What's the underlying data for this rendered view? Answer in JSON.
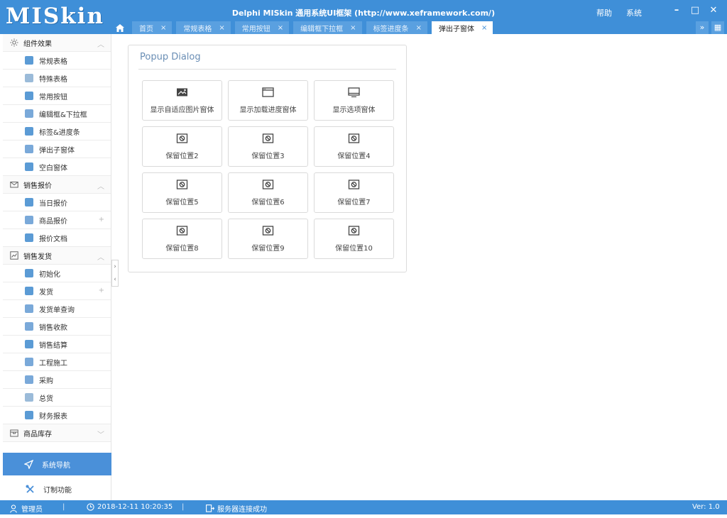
{
  "app": {
    "logo": "MISkin",
    "title": "Delphi MISkin 通用系统UI框架 (http://www.xeframework.com/)",
    "top_links": [
      "帮助",
      "系统"
    ],
    "window_controls": {
      "minimize": "–",
      "maximize": "□",
      "close": "✕"
    }
  },
  "tabs": [
    {
      "label": "首页",
      "active": false
    },
    {
      "label": "常规表格",
      "active": false
    },
    {
      "label": "常用按钮",
      "active": false
    },
    {
      "label": "编辑框下拉框",
      "active": false
    },
    {
      "label": "标签进度条",
      "active": false
    },
    {
      "label": "弹出子窗体",
      "active": true
    }
  ],
  "tab_close": "×",
  "tab_tools": {
    "dropdown": "»",
    "grid": "▦"
  },
  "sidebar": {
    "groups": [
      {
        "label": "组件效果",
        "icon": "gear-icon",
        "toggle": "︿",
        "items": [
          {
            "label": "常规表格",
            "icon": "grid-icon",
            "color": "#5b9bd5"
          },
          {
            "label": "特殊表格",
            "icon": "document-icon",
            "color": "#9bbbd9"
          },
          {
            "label": "常用按钮",
            "icon": "button-icon",
            "color": "#5b9bd5"
          },
          {
            "label": "编辑框&下拉框",
            "icon": "edit-icon",
            "color": "#7aa9d9"
          },
          {
            "label": "标签&进度条",
            "icon": "tag-icon",
            "color": "#5b9bd5"
          },
          {
            "label": "弹出子窗体",
            "icon": "window-icon",
            "color": "#7aa9d9"
          },
          {
            "label": "空白窗体",
            "icon": "home-icon",
            "color": "#5b9bd5"
          }
        ]
      },
      {
        "label": "销售报价",
        "icon": "mail-icon",
        "toggle": "︿",
        "items": [
          {
            "label": "当日报价",
            "icon": "calendar-icon",
            "color": "#5b9bd5"
          },
          {
            "label": "商品报价",
            "icon": "table-icon",
            "color": "#7aa9d9",
            "right": "+"
          },
          {
            "label": "报价文档",
            "icon": "folder-icon",
            "color": "#5b9bd5"
          }
        ]
      },
      {
        "label": "销售发货",
        "icon": "chart-icon",
        "toggle": "︿",
        "items": [
          {
            "label": "初始化",
            "icon": "init-icon",
            "color": "#5b9bd5"
          },
          {
            "label": "发货",
            "icon": "truck-icon",
            "color": "#5b9bd5",
            "right": "+"
          },
          {
            "label": "发货单查询",
            "icon": "house-icon",
            "color": "#7aa9d9"
          },
          {
            "label": "销售收款",
            "icon": "check-icon",
            "color": "#7aa9d9"
          },
          {
            "label": "销售结算",
            "icon": "money-icon",
            "color": "#5b9bd5"
          },
          {
            "label": "工程施工",
            "icon": "helmet-icon",
            "color": "#7aa9d9"
          },
          {
            "label": "采购",
            "icon": "users-icon",
            "color": "#7aa9d9"
          },
          {
            "label": "总货",
            "icon": "list-icon",
            "color": "#9bbbd9"
          },
          {
            "label": "财务报表",
            "icon": "report-icon",
            "color": "#5b9bd5"
          }
        ]
      },
      {
        "label": "商品库存",
        "icon": "box-icon",
        "toggle": "﹀",
        "items": []
      }
    ],
    "nav_label": "系统导航",
    "custom_label": "订制功能",
    "collapse": {
      "right": "›",
      "left": "‹"
    }
  },
  "panel": {
    "title": "Popup Dialog",
    "buttons": [
      {
        "label": "显示自适应图片窗体",
        "icon": "image-icon"
      },
      {
        "label": "显示加载进度窗体",
        "icon": "browser-window-icon"
      },
      {
        "label": "显示选项窗体",
        "icon": "monitor-icon"
      },
      {
        "label": "保留位置2",
        "icon": "ban-icon"
      },
      {
        "label": "保留位置3",
        "icon": "ban-icon"
      },
      {
        "label": "保留位置4",
        "icon": "ban-icon"
      },
      {
        "label": "保留位置5",
        "icon": "ban-icon"
      },
      {
        "label": "保留位置6",
        "icon": "ban-icon"
      },
      {
        "label": "保留位置7",
        "icon": "ban-icon"
      },
      {
        "label": "保留位置8",
        "icon": "ban-icon"
      },
      {
        "label": "保留位置9",
        "icon": "ban-icon"
      },
      {
        "label": "保留位置10",
        "icon": "ban-icon"
      }
    ]
  },
  "status": {
    "user": "管理员",
    "datetime": "2018-12-11 10:20:35",
    "server": "服务器连接成功",
    "separator": "|",
    "version": "Ver: 1.0"
  },
  "colors": {
    "brand": "#3f8fd8",
    "nav_active": "#4a90d9"
  }
}
